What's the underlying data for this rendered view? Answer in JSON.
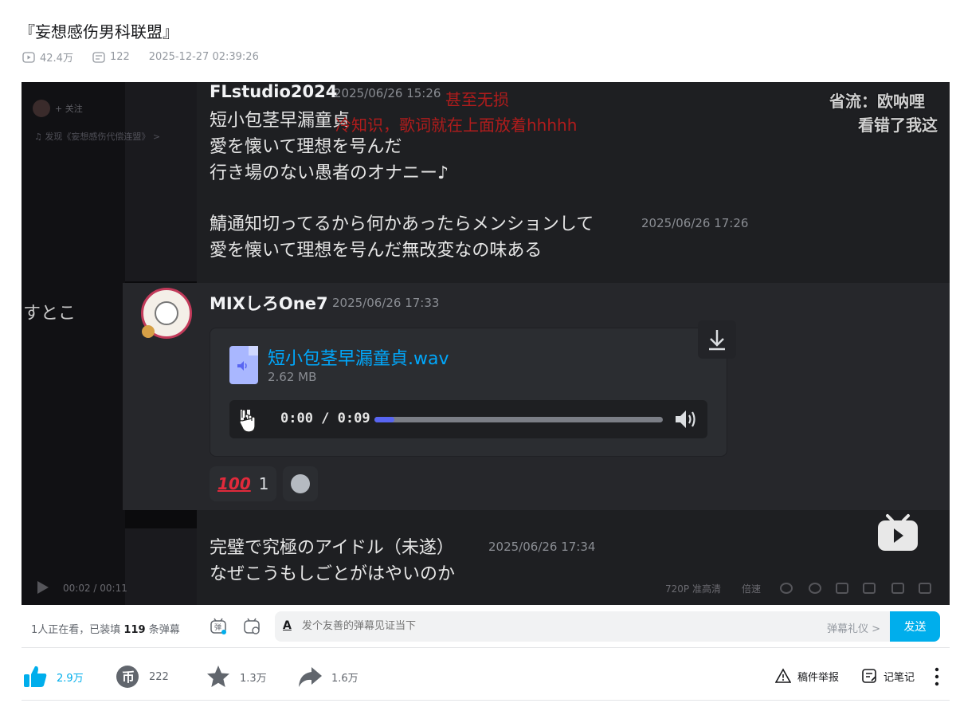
{
  "video": {
    "title": "『妄想感伤男科联盟』",
    "views": "42.4万",
    "danmaku_count": "122",
    "date": "2025-12-27 02:39:26"
  },
  "player": {
    "left_follow": "+ 关注",
    "left_music": "发现《妄想感伤代偿连盟》 >",
    "left_text": "すとこ",
    "messages": {
      "m1_user": "FLstudio2024",
      "m1_time": "2025/06/26 15:26",
      "m1_line1": "短小包茎早漏童貞",
      "m1_line2": "愛を懐いて理想を号んだ",
      "m1_line3": "行き場のない愚者のオナニー♪",
      "m1_line4": "鯖通知切ってるから何かあったらメンションして",
      "m1_line4_time": "2025/06/26 17:26",
      "m1_line5": "愛を懐いて理想を号んだ無改変なの味ある",
      "m2_user": "MIXしろOne7",
      "m2_time": "2025/06/26 17:33",
      "file_name": "短小包茎早漏童貞.wav",
      "file_size": "2.62 MB",
      "audio_time": "0:00 / 0:09",
      "audio_progress": 0.07,
      "reaction_emoji": "100",
      "reaction_count": "1",
      "m3_line1": "完璧で究極のアイドル（未遂）",
      "m3_time": "2025/06/26 17:34",
      "m3_line2": "なぜこうもしごとがはやいのか"
    },
    "danmaku": {
      "d1": "甚至无损",
      "d2": "冷知识，歌词就在上面放着hhhhh",
      "d3": "省流：欧呐哩",
      "d4": "看错了我这"
    },
    "controls": {
      "time": "00:02 / 00:11",
      "quality": "720P 准高清",
      "speed": "倍速"
    }
  },
  "danmaku_bar": {
    "viewers_prefix": "1人正在看，已装填",
    "loaded_count": "119",
    "viewers_suffix": "条弹幕",
    "input_placeholder": "发个友善的弹幕见证当下",
    "etiquette": "弹幕礼仪 >",
    "send": "发送"
  },
  "toolbar": {
    "like": "2.9万",
    "coin": "222",
    "favorite": "1.3万",
    "share": "1.6万",
    "report": "稿件举报",
    "notes": "记笔记"
  },
  "colors": {
    "accent": "#00aeec",
    "discord_link": "#00a8fc",
    "danmaku_red": "#b01c1c"
  }
}
